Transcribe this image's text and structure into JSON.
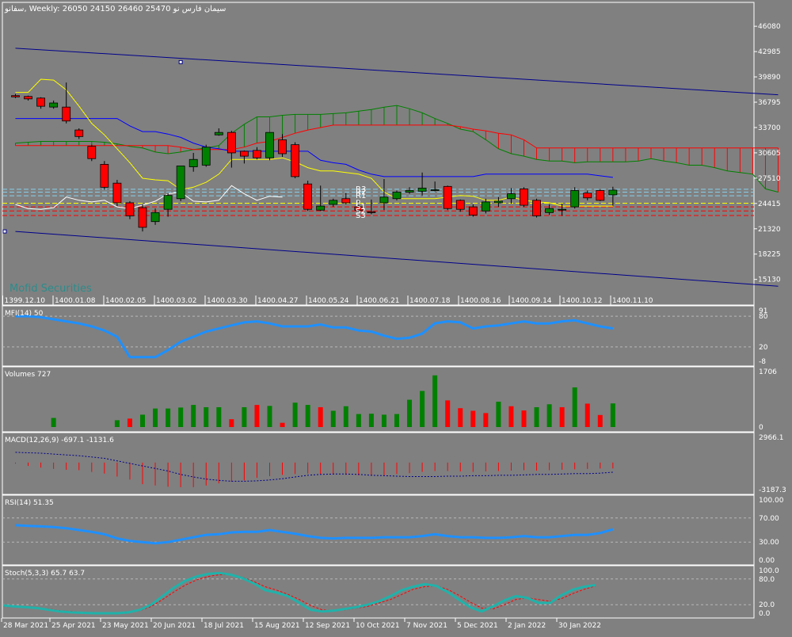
{
  "header": {
    "symbol": "سفانو",
    "timeframe": "Weekly:",
    "ohlc": "26050 24150 26460 25470",
    "name_fa": "سیمان فارس نو"
  },
  "watermark": "Mofid Securities",
  "colors": {
    "bg": "#808080",
    "grid": "#b8b8b8",
    "up": "#008000",
    "down": "#ff0000",
    "channel": "#00008b",
    "tenkan": "#ffff00",
    "kijun": "#0000ff",
    "chikou": "#ffffff",
    "cloud_up": "#008000",
    "cloud_down": "#ff0000",
    "indicator_line": "#1e90ff",
    "rsi_line": "#1e90ff",
    "stoch_main": "#20b2aa",
    "stoch_signal": "#ff0000"
  },
  "chart_data": [
    {
      "type": "candlestick",
      "panel": "price",
      "ylim": [
        12000,
        49000
      ],
      "yticks": [
        "46080",
        "42985",
        "39890",
        "36795",
        "33700",
        "30605",
        "27510",
        "24415",
        "21320",
        "18225",
        "15130"
      ],
      "ytick_values": [
        46080,
        42985,
        39890,
        36795,
        33700,
        30605,
        27510,
        24415,
        21320,
        18225,
        15130
      ],
      "xlabels_top": [
        "1399.12.10",
        "1400.01.08",
        "1400.02.05",
        "1400.03.02",
        "1400.03.30",
        "1400.04.27",
        "1400.05.24",
        "1400.06.21",
        "1400.07.18",
        "1400.08.16",
        "1400.09.14",
        "1400.10.12",
        "1400.11.10"
      ],
      "pivot_labels": [
        "R3",
        "R2",
        "R1",
        "P",
        "S1",
        "S2",
        "S3"
      ],
      "pivot_values": [
        26150,
        25800,
        25350,
        24450,
        24000,
        23500,
        22950
      ],
      "candles": [
        {
          "o": 37600,
          "h": 37800,
          "c": 37450,
          "l": 37300
        },
        {
          "o": 37500,
          "h": 37600,
          "c": 37200,
          "l": 37000
        },
        {
          "o": 37300,
          "h": 37400,
          "c": 36300,
          "l": 36000
        },
        {
          "o": 36200,
          "h": 37000,
          "c": 36700,
          "l": 36000
        },
        {
          "o": 36200,
          "h": 39200,
          "c": 34500,
          "l": 34200
        },
        {
          "o": 33400,
          "h": 33600,
          "c": 32600,
          "l": 32300
        },
        {
          "o": 31400,
          "h": 31600,
          "c": 29900,
          "l": 29600
        },
        {
          "o": 29200,
          "h": 29600,
          "c": 26400,
          "l": 26100
        },
        {
          "o": 26900,
          "h": 27300,
          "c": 24500,
          "l": 24100
        },
        {
          "o": 24500,
          "h": 24700,
          "c": 22900,
          "l": 22500
        },
        {
          "o": 23900,
          "h": 24300,
          "c": 21500,
          "l": 21000
        },
        {
          "o": 22200,
          "h": 23800,
          "c": 23300,
          "l": 21800
        },
        {
          "o": 23700,
          "h": 25700,
          "c": 25400,
          "l": 22800
        },
        {
          "o": 25000,
          "h": 29000,
          "c": 29000,
          "l": 24700
        },
        {
          "o": 28900,
          "h": 30600,
          "c": 29800,
          "l": 28300
        },
        {
          "o": 29100,
          "h": 31600,
          "c": 31300,
          "l": 28900
        },
        {
          "o": 32800,
          "h": 33600,
          "c": 33100,
          "l": 32700
        },
        {
          "o": 33100,
          "h": 33300,
          "c": 30600,
          "l": 28800
        },
        {
          "o": 30800,
          "h": 30900,
          "c": 30200,
          "l": 29300
        },
        {
          "o": 30900,
          "h": 31300,
          "c": 30000,
          "l": 29800
        },
        {
          "o": 30000,
          "h": 33100,
          "c": 33100,
          "l": 29700
        },
        {
          "o": 32200,
          "h": 32900,
          "c": 30500,
          "l": 30100
        },
        {
          "o": 31600,
          "h": 31900,
          "c": 27700,
          "l": 27500
        },
        {
          "o": 26800,
          "h": 27200,
          "c": 23700,
          "l": 23500
        },
        {
          "o": 23600,
          "h": 26600,
          "c": 24100,
          "l": 23500
        },
        {
          "o": 24300,
          "h": 25000,
          "c": 24800,
          "l": 24000
        },
        {
          "o": 25000,
          "h": 25700,
          "c": 24500,
          "l": 24300
        },
        {
          "o": 24000,
          "h": 24800,
          "c": 23600,
          "l": 23400
        },
        {
          "o": 23400,
          "h": 24900,
          "c": 23300,
          "l": 23100
        },
        {
          "o": 24500,
          "h": 27400,
          "c": 25200,
          "l": 23600
        },
        {
          "o": 25000,
          "h": 26000,
          "c": 25800,
          "l": 24800
        },
        {
          "o": 25800,
          "h": 26400,
          "c": 26000,
          "l": 25600
        },
        {
          "o": 25900,
          "h": 28200,
          "c": 26300,
          "l": 25400
        },
        {
          "o": 26000,
          "h": 27100,
          "c": 26100,
          "l": 25900
        },
        {
          "o": 26500,
          "h": 26600,
          "c": 23800,
          "l": 23600
        },
        {
          "o": 24800,
          "h": 24900,
          "c": 23700,
          "l": 23400
        },
        {
          "o": 24000,
          "h": 24300,
          "c": 23000,
          "l": 22800
        },
        {
          "o": 23500,
          "h": 25000,
          "c": 24600,
          "l": 23200
        },
        {
          "o": 24500,
          "h": 25200,
          "c": 24700,
          "l": 24000
        },
        {
          "o": 25000,
          "h": 26300,
          "c": 25600,
          "l": 24400
        },
        {
          "o": 26200,
          "h": 26400,
          "c": 24200,
          "l": 24000
        },
        {
          "o": 24800,
          "h": 25000,
          "c": 22900,
          "l": 22700
        },
        {
          "o": 23300,
          "h": 24300,
          "c": 23800,
          "l": 23000
        },
        {
          "o": 23700,
          "h": 24400,
          "c": 23700,
          "l": 22900
        },
        {
          "o": 24000,
          "h": 26400,
          "c": 26000,
          "l": 23800
        },
        {
          "o": 25700,
          "h": 26000,
          "c": 25100,
          "l": 24800
        },
        {
          "o": 26000,
          "h": 26100,
          "c": 24800,
          "l": 24700
        },
        {
          "o": 25470,
          "h": 26460,
          "c": 26050,
          "l": 24150
        }
      ],
      "channel": {
        "upper": [
          [
            0,
            43400
          ],
          [
            60,
            37700
          ]
        ],
        "lower": [
          [
            0,
            21000
          ],
          [
            60,
            14300
          ]
        ]
      },
      "tenkan": [
        38000,
        38000,
        39600,
        39500,
        38300,
        36300,
        34200,
        32800,
        31100,
        29400,
        27500,
        27300,
        27200,
        26100,
        26400,
        27000,
        28000,
        29800,
        29800,
        29800,
        29800,
        30000,
        29500,
        28800,
        28400,
        28400,
        28200,
        28000,
        27500,
        25800,
        25000,
        25000,
        25000,
        25000,
        25200,
        25400,
        25300,
        24800,
        24800,
        25200,
        24800,
        24600,
        24500,
        24100,
        24100,
        24100,
        24100,
        24100
      ],
      "kijun": [
        34800,
        34800,
        34800,
        34800,
        34800,
        34800,
        34800,
        34800,
        34800,
        33900,
        33200,
        33200,
        32900,
        32500,
        31800,
        31300,
        31100,
        30800,
        30800,
        30800,
        30800,
        30800,
        30800,
        30800,
        29700,
        29400,
        29200,
        28500,
        28000,
        27700,
        27700,
        27700,
        27700,
        27700,
        27700,
        27700,
        27700,
        28000,
        28000,
        28000,
        28000,
        28000,
        28000,
        28000,
        28000,
        28000,
        27800,
        27600
      ],
      "chikou": [
        24300,
        23800,
        23700,
        23900,
        25200,
        24800,
        24600,
        24800,
        24000,
        23800,
        24200,
        24700,
        25600,
        25800,
        24700,
        24600,
        24800,
        26600,
        25600,
        24800,
        25300,
        25200
      ],
      "cloud_a": [
        31800,
        31900,
        32000,
        32000,
        32000,
        32000,
        32000,
        31900,
        31700,
        31400,
        31200,
        30700,
        30500,
        30700,
        31000,
        31200,
        31500,
        33000,
        34100,
        35000,
        35000,
        35200,
        35300,
        35300,
        35300,
        35400,
        35500,
        35700,
        35900,
        36200,
        36400,
        36000,
        35500,
        34800,
        34200,
        33500,
        33200,
        32200,
        31100,
        30500,
        30200,
        29800,
        29600,
        29600,
        29400,
        29500,
        29500,
        29500,
        29500,
        29600,
        29900,
        29600,
        29400,
        29100,
        29100,
        28800,
        28400,
        28200,
        28000,
        26200,
        25800
      ],
      "cloud_b": [
        31500,
        31500,
        31500,
        31500,
        31500,
        31500,
        31500,
        31500,
        31500,
        31500,
        31500,
        31500,
        31500,
        31300,
        31000,
        31000,
        31000,
        31000,
        31300,
        31800,
        32000,
        32500,
        33000,
        33400,
        33700,
        34000,
        34000,
        34000,
        34000,
        34000,
        34000,
        34000,
        34000,
        34000,
        34000,
        33800,
        33500,
        33300,
        33000,
        32800,
        32200,
        31200,
        31200,
        31200,
        31200,
        31200,
        31200,
        31200,
        31200,
        31200,
        31200,
        31200,
        31200,
        31200,
        31200,
        31200,
        31200,
        31200,
        31200,
        31200,
        31200
      ]
    },
    {
      "type": "line",
      "panel": "mfi",
      "label": "MFI(14) 50",
      "ylim": [
        -8,
        91
      ],
      "yticks": [
        "91",
        "80",
        "20",
        "-8"
      ],
      "ytick_values": [
        91,
        80,
        20,
        -8
      ],
      "levels": [
        80,
        20
      ],
      "values": [
        80,
        80,
        78,
        74,
        70,
        66,
        60,
        52,
        40,
        0,
        0,
        0,
        14,
        30,
        40,
        50,
        56,
        62,
        68,
        70,
        66,
        60,
        60,
        60,
        64,
        58,
        58,
        52,
        50,
        42,
        36,
        38,
        46,
        66,
        70,
        68,
        56,
        60,
        62,
        66,
        70,
        66,
        66,
        70,
        72,
        66,
        60,
        56
      ]
    },
    {
      "type": "bar",
      "panel": "volume",
      "label": "Volumes 727",
      "ylim": [
        0,
        1706
      ],
      "yticks": [
        "1706",
        "0"
      ],
      "ytick_values": [
        1706,
        0
      ],
      "values": [
        0,
        0,
        0,
        280,
        0,
        0,
        0,
        0,
        210,
        260,
        380,
        570,
        570,
        600,
        680,
        610,
        610,
        240,
        610,
        680,
        650,
        130,
        750,
        680,
        610,
        500,
        640,
        400,
        410,
        380,
        400,
        840,
        1110,
        1590,
        820,
        580,
        500,
        430,
        780,
        640,
        510,
        610,
        700,
        610,
        1220,
        720,
        370,
        727
      ],
      "up": [
        true,
        true,
        true,
        true,
        true,
        true,
        true,
        true,
        true,
        false,
        true,
        true,
        true,
        true,
        true,
        true,
        true,
        false,
        true,
        false,
        true,
        false,
        true,
        true,
        false,
        true,
        true,
        true,
        true,
        true,
        true,
        true,
        true,
        true,
        false,
        false,
        false,
        false,
        true,
        false,
        false,
        true,
        true,
        false,
        true,
        false,
        false,
        true
      ]
    },
    {
      "type": "bar_line",
      "panel": "macd",
      "label": "MACD(12,26,9) -697.1 -1131.6",
      "ylim": [
        -3187.3,
        2966.1
      ],
      "yticks": [
        "2966.1",
        "-3187.3"
      ],
      "ytick_values": [
        2966.1,
        -3187.3
      ],
      "macd": [
        -120,
        -400,
        -600,
        -750,
        -850,
        -900,
        -1100,
        -1300,
        -1650,
        -2000,
        -2550,
        -2700,
        -2850,
        -2900,
        -2900,
        -2700,
        -2450,
        -2250,
        -2100,
        -1800,
        -1600,
        -1450,
        -1350,
        -1300,
        -1350,
        -1400,
        -1450,
        -1500,
        -1550,
        -1500,
        -1350,
        -1250,
        -1100,
        -1000,
        -1000,
        -1050,
        -1100,
        -1050,
        -1000,
        -950,
        -900,
        -950,
        -900,
        -850,
        -800,
        -750,
        -700,
        -697.1
      ],
      "signal": [
        1200,
        1150,
        1100,
        1000,
        900,
        800,
        650,
        500,
        200,
        -100,
        -400,
        -700,
        -1000,
        -1400,
        -1700,
        -1950,
        -2100,
        -2200,
        -2200,
        -2150,
        -2050,
        -1900,
        -1700,
        -1500,
        -1400,
        -1350,
        -1350,
        -1400,
        -1500,
        -1550,
        -1600,
        -1650,
        -1650,
        -1650,
        -1600,
        -1600,
        -1550,
        -1550,
        -1500,
        -1500,
        -1450,
        -1400,
        -1400,
        -1350,
        -1300,
        -1300,
        -1250,
        -1131.6
      ]
    },
    {
      "type": "line",
      "panel": "rsi",
      "label": "RSI(14) 51.35",
      "ylim": [
        0,
        100
      ],
      "yticks": [
        "100.00",
        "70.00",
        "30.00",
        "0.00"
      ],
      "ytick_values": [
        100,
        70,
        30,
        0
      ],
      "levels": [
        70,
        30
      ],
      "values": [
        58,
        57,
        56,
        55,
        53,
        50,
        47,
        43,
        36,
        32,
        30,
        28,
        30,
        34,
        38,
        42,
        43,
        46,
        47,
        47,
        50,
        47,
        44,
        40,
        37,
        36,
        37,
        37,
        37,
        38,
        38,
        38,
        40,
        43,
        40,
        38,
        38,
        37,
        37,
        38,
        40,
        38,
        38,
        40,
        42,
        42,
        45,
        51.35
      ]
    },
    {
      "type": "line",
      "panel": "stoch",
      "label": "Stoch(5,3,3) 65.7 63.7",
      "ylim": [
        0,
        100
      ],
      "yticks": [
        "100.0",
        "80.0",
        "20.0",
        "0.0"
      ],
      "ytick_values": [
        100,
        80,
        20,
        0
      ],
      "levels": [
        80,
        20
      ],
      "main": [
        18,
        16,
        14,
        12,
        8,
        4,
        2,
        1,
        0,
        0,
        0,
        2,
        8,
        20,
        40,
        60,
        76,
        86,
        92,
        94,
        90,
        82,
        70,
        54,
        48,
        40,
        24,
        8,
        4,
        6,
        10,
        14,
        20,
        28,
        40,
        54,
        62,
        68,
        64,
        50,
        32,
        14,
        4,
        16,
        30,
        40,
        36,
        24,
        24,
        42,
        55,
        62,
        65.7
      ],
      "signal": [
        16,
        15,
        14,
        12,
        10,
        6,
        4,
        2,
        0,
        0,
        0,
        2,
        6,
        16,
        32,
        50,
        66,
        78,
        86,
        90,
        90,
        84,
        74,
        62,
        54,
        44,
        32,
        18,
        8,
        6,
        8,
        12,
        16,
        24,
        32,
        44,
        56,
        62,
        64,
        56,
        42,
        26,
        12,
        10,
        20,
        32,
        36,
        32,
        28,
        34,
        46,
        56,
        63.7
      ]
    },
    {
      "type": "axis",
      "panel": "x_bottom",
      "labels": [
        "28 Mar 2021",
        "25 Apr 2021",
        "23 May 2021",
        "20 Jun 2021",
        "18 Jul 2021",
        "15 Aug 2021",
        "12 Sep 2021",
        "10 Oct 2021",
        "7 Nov 2021",
        "5 Dec 2021",
        "2 Jan 2022",
        "30 Jan 2022"
      ]
    }
  ]
}
